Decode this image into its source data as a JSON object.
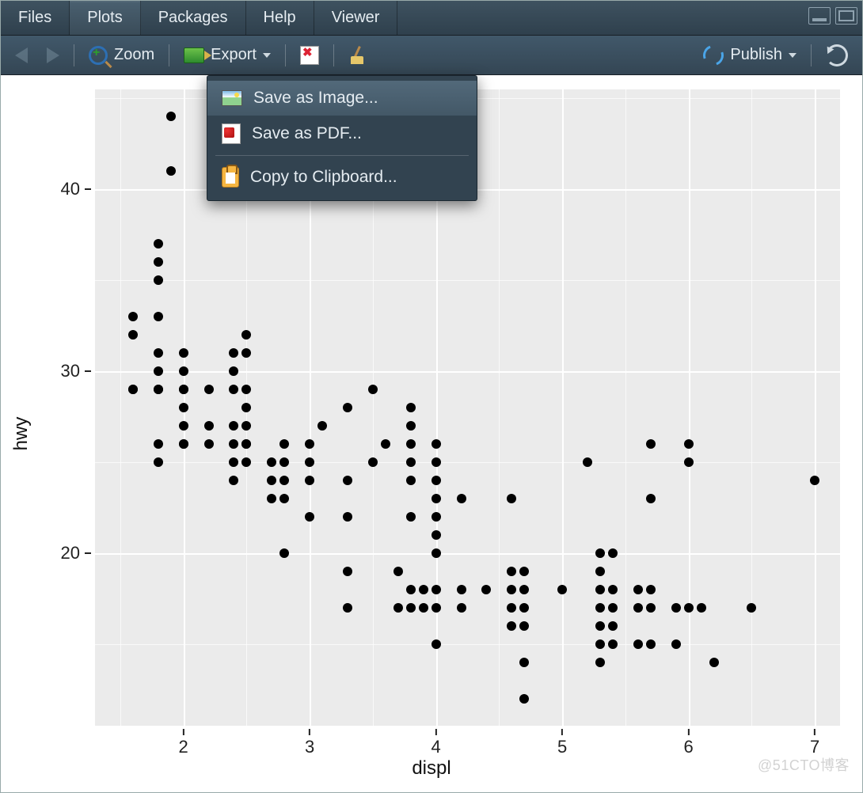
{
  "tabs": {
    "files": "Files",
    "plots": "Plots",
    "packages": "Packages",
    "help": "Help",
    "viewer": "Viewer",
    "active": "plots"
  },
  "toolbar": {
    "zoom_label": "Zoom",
    "export_label": "Export",
    "publish_label": "Publish"
  },
  "export_menu": {
    "save_image": "Save as Image...",
    "save_pdf": "Save as PDF...",
    "copy_clip": "Copy to Clipboard...",
    "hovered": "save_image"
  },
  "chart_data": {
    "type": "scatter",
    "xlabel": "displ",
    "ylabel": "hwy",
    "xlim": [
      1.3,
      7.2
    ],
    "ylim": [
      10.5,
      45.5
    ],
    "x_ticks": [
      2,
      3,
      4,
      5,
      6,
      7
    ],
    "y_ticks": [
      20,
      30,
      40
    ],
    "x_minor": [
      1.5,
      2.5,
      3.5,
      4.5,
      5.5,
      6.5
    ],
    "y_minor": [
      15,
      25,
      35,
      45
    ],
    "points": [
      [
        1.6,
        33
      ],
      [
        1.6,
        32
      ],
      [
        1.6,
        29
      ],
      [
        1.6,
        29
      ],
      [
        1.8,
        29
      ],
      [
        1.8,
        29
      ],
      [
        1.8,
        30
      ],
      [
        1.8,
        31
      ],
      [
        1.8,
        33
      ],
      [
        1.8,
        35
      ],
      [
        1.8,
        36
      ],
      [
        1.8,
        37
      ],
      [
        1.8,
        26
      ],
      [
        1.8,
        25
      ],
      [
        1.9,
        44
      ],
      [
        1.9,
        41
      ],
      [
        2.0,
        29
      ],
      [
        2.0,
        30
      ],
      [
        2.0,
        31
      ],
      [
        2.0,
        28
      ],
      [
        2.0,
        27
      ],
      [
        2.0,
        26
      ],
      [
        2.0,
        29
      ],
      [
        2.0,
        26
      ],
      [
        2.2,
        27
      ],
      [
        2.2,
        29
      ],
      [
        2.2,
        26
      ],
      [
        2.4,
        30
      ],
      [
        2.4,
        31
      ],
      [
        2.4,
        27
      ],
      [
        2.4,
        26
      ],
      [
        2.4,
        24
      ],
      [
        2.4,
        25
      ],
      [
        2.4,
        29
      ],
      [
        2.5,
        32
      ],
      [
        2.5,
        31
      ],
      [
        2.5,
        29
      ],
      [
        2.5,
        28
      ],
      [
        2.5,
        27
      ],
      [
        2.5,
        26
      ],
      [
        2.5,
        25
      ],
      [
        2.5,
        26
      ],
      [
        2.7,
        24
      ],
      [
        2.7,
        25
      ],
      [
        2.7,
        23
      ],
      [
        2.8,
        26
      ],
      [
        2.8,
        25
      ],
      [
        2.8,
        24
      ],
      [
        2.8,
        23
      ],
      [
        2.8,
        20
      ],
      [
        3.0,
        26
      ],
      [
        3.0,
        25
      ],
      [
        3.0,
        24
      ],
      [
        3.0,
        22
      ],
      [
        3.1,
        27
      ],
      [
        3.3,
        28
      ],
      [
        3.3,
        24
      ],
      [
        3.3,
        22
      ],
      [
        3.3,
        19
      ],
      [
        3.3,
        17
      ],
      [
        3.5,
        29
      ],
      [
        3.5,
        25
      ],
      [
        3.6,
        26
      ],
      [
        3.7,
        19
      ],
      [
        3.7,
        17
      ],
      [
        3.8,
        28
      ],
      [
        3.8,
        27
      ],
      [
        3.8,
        26
      ],
      [
        3.8,
        25
      ],
      [
        3.8,
        24
      ],
      [
        3.8,
        22
      ],
      [
        3.8,
        18
      ],
      [
        3.8,
        17
      ],
      [
        3.9,
        18
      ],
      [
        3.9,
        17
      ],
      [
        4.0,
        26
      ],
      [
        4.0,
        25
      ],
      [
        4.0,
        24
      ],
      [
        4.0,
        23
      ],
      [
        4.0,
        22
      ],
      [
        4.0,
        21
      ],
      [
        4.0,
        20
      ],
      [
        4.0,
        18
      ],
      [
        4.0,
        17
      ],
      [
        4.0,
        15
      ],
      [
        4.2,
        23
      ],
      [
        4.2,
        18
      ],
      [
        4.2,
        17
      ],
      [
        4.4,
        18
      ],
      [
        4.6,
        23
      ],
      [
        4.6,
        19
      ],
      [
        4.6,
        18
      ],
      [
        4.6,
        17
      ],
      [
        4.6,
        16
      ],
      [
        4.7,
        19
      ],
      [
        4.7,
        18
      ],
      [
        4.7,
        17
      ],
      [
        4.7,
        16
      ],
      [
        4.7,
        14
      ],
      [
        4.7,
        12
      ],
      [
        5.0,
        18
      ],
      [
        5.2,
        25
      ],
      [
        5.3,
        20
      ],
      [
        5.3,
        19
      ],
      [
        5.3,
        18
      ],
      [
        5.3,
        17
      ],
      [
        5.3,
        16
      ],
      [
        5.3,
        15
      ],
      [
        5.3,
        14
      ],
      [
        5.4,
        20
      ],
      [
        5.4,
        18
      ],
      [
        5.4,
        17
      ],
      [
        5.4,
        16
      ],
      [
        5.4,
        15
      ],
      [
        5.6,
        18
      ],
      [
        5.6,
        17
      ],
      [
        5.6,
        15
      ],
      [
        5.7,
        26
      ],
      [
        5.7,
        23
      ],
      [
        5.7,
        18
      ],
      [
        5.7,
        17
      ],
      [
        5.7,
        15
      ],
      [
        5.9,
        17
      ],
      [
        5.9,
        15
      ],
      [
        6.0,
        26
      ],
      [
        6.0,
        25
      ],
      [
        6.0,
        17
      ],
      [
        6.1,
        17
      ],
      [
        6.2,
        14
      ],
      [
        6.5,
        17
      ],
      [
        7.0,
        24
      ]
    ]
  },
  "watermark": "@51CTO博客"
}
